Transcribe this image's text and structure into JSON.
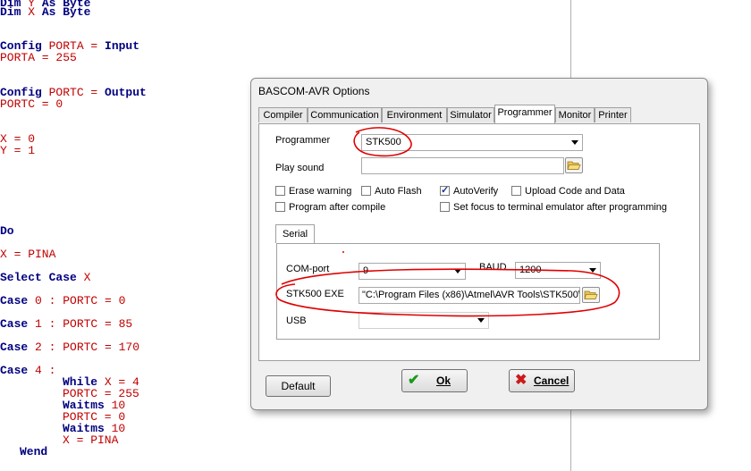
{
  "editor": {
    "lines": [
      {
        "parts": [
          {
            "t": "Dim ",
            "c": "kw"
          },
          {
            "t": "Y ",
            "c": "tx"
          },
          {
            "t": "As Byte",
            "c": "kw"
          }
        ]
      },
      {
        "parts": [
          {
            "t": "Dim ",
            "c": "kw"
          },
          {
            "t": "X ",
            "c": "tx"
          },
          {
            "t": "As Byte",
            "c": "kw"
          }
        ]
      },
      {
        "parts": [
          {
            "t": "Config ",
            "c": "kw"
          },
          {
            "t": "PORTA ",
            "c": "tx"
          },
          {
            "t": "= ",
            "c": "op"
          },
          {
            "t": "Input",
            "c": "kw"
          }
        ]
      },
      {
        "parts": [
          {
            "t": "PORTA = 255",
            "c": "tx"
          }
        ]
      },
      {
        "parts": [
          {
            "t": "Config ",
            "c": "kw"
          },
          {
            "t": "PORTC ",
            "c": "tx"
          },
          {
            "t": "= ",
            "c": "op"
          },
          {
            "t": "Output",
            "c": "kw"
          }
        ]
      },
      {
        "parts": [
          {
            "t": "PORTC = 0",
            "c": "tx"
          }
        ]
      },
      {
        "parts": [
          {
            "t": "X = 0",
            "c": "tx"
          }
        ]
      },
      {
        "parts": [
          {
            "t": "Y = 1",
            "c": "tx"
          }
        ]
      },
      {
        "parts": [
          {
            "t": "Do",
            "c": "kw"
          }
        ]
      },
      {
        "parts": [
          {
            "t": "X = PINA",
            "c": "tx"
          }
        ]
      },
      {
        "parts": [
          {
            "t": "Select Case ",
            "c": "kw"
          },
          {
            "t": "X",
            "c": "tx"
          }
        ]
      },
      {
        "parts": [
          {
            "t": "Case ",
            "c": "kw"
          },
          {
            "t": "0 : PORTC = 0",
            "c": "tx"
          }
        ]
      },
      {
        "parts": [
          {
            "t": "Case ",
            "c": "kw"
          },
          {
            "t": "1 : PORTC = 85",
            "c": "tx"
          }
        ]
      },
      {
        "parts": [
          {
            "t": "Case ",
            "c": "kw"
          },
          {
            "t": "2 : PORTC = 170",
            "c": "tx"
          }
        ]
      },
      {
        "parts": [
          {
            "t": "Case ",
            "c": "kw"
          },
          {
            "t": "4 :",
            "c": "tx"
          }
        ]
      },
      {
        "parts": [
          {
            "t": "While ",
            "c": "kw"
          },
          {
            "t": "X = 4",
            "c": "tx"
          }
        ]
      },
      {
        "parts": [
          {
            "t": "PORTC = 255",
            "c": "tx"
          }
        ]
      },
      {
        "parts": [
          {
            "t": "Waitms ",
            "c": "kw"
          },
          {
            "t": "10",
            "c": "tx"
          }
        ]
      },
      {
        "parts": [
          {
            "t": "PORTC = 0",
            "c": "tx"
          }
        ]
      },
      {
        "parts": [
          {
            "t": "Waitms ",
            "c": "kw"
          },
          {
            "t": "10",
            "c": "tx"
          }
        ]
      },
      {
        "parts": [
          {
            "t": "X = PINA",
            "c": "tx"
          }
        ]
      },
      {
        "parts": [
          {
            "t": "Wend",
            "c": "kw"
          }
        ]
      }
    ]
  },
  "dialog": {
    "title": "BASCOM-AVR Options",
    "tabs": [
      "Compiler",
      "Communication",
      "Environment",
      "Simulator",
      "Programmer",
      "Monitor",
      "Printer"
    ],
    "active_tab": "Programmer",
    "programmer_label": "Programmer",
    "programmer_value": "STK500",
    "play_sound_label": "Play sound",
    "play_sound_value": "",
    "checkboxes": {
      "erase_warning": {
        "label": "Erase warning",
        "checked": false
      },
      "auto_flash": {
        "label": "Auto Flash",
        "checked": false
      },
      "auto_verify": {
        "label": "AutoVerify",
        "checked": true
      },
      "upload_code": {
        "label": "Upload Code and Data",
        "checked": false
      },
      "program_after_compile": {
        "label": "Program after compile",
        "checked": false
      },
      "set_focus": {
        "label": "Set focus to terminal emulator after programming",
        "checked": false
      }
    },
    "serial_tab": "Serial",
    "com_port_label": "COM-port",
    "com_port_value": "9",
    "baud_label": "BAUD",
    "baud_value": "1200",
    "stk500_exe_label": "STK500 EXE",
    "stk500_exe_value": "\"C:\\Program Files (x86)\\Atmel\\AVR Tools\\STK500\\",
    "usb_label": "USB",
    "usb_value": "",
    "default_button": "Default",
    "ok_button": "Ok",
    "cancel_button": "Cancel"
  },
  "colors": {
    "keyword": "#000080",
    "text": "#c00000",
    "annotation": "#e00000",
    "ok_check": "#1a9a1a",
    "cancel_x": "#cc1a1a"
  }
}
